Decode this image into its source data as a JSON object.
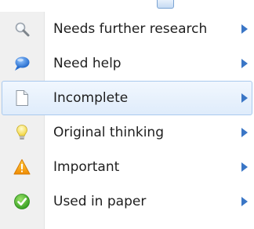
{
  "menu": {
    "items": [
      {
        "label": "Needs further research",
        "icon": "magnifier-icon",
        "has_submenu": true,
        "selected": false
      },
      {
        "label": "Need help",
        "icon": "speech-bubble-icon",
        "has_submenu": true,
        "selected": false
      },
      {
        "label": "Incomplete",
        "icon": "blank-page-icon",
        "has_submenu": true,
        "selected": true
      },
      {
        "label": "Original thinking",
        "icon": "lightbulb-icon",
        "has_submenu": true,
        "selected": false
      },
      {
        "label": "Important",
        "icon": "warning-icon",
        "has_submenu": true,
        "selected": false
      },
      {
        "label": "Used in paper",
        "icon": "checkmark-icon",
        "has_submenu": true,
        "selected": false
      }
    ]
  },
  "colors": {
    "selection_border": "#a9c9ee",
    "submenu_arrow": "#3a76c6",
    "gutter": "#f0f0f0"
  }
}
